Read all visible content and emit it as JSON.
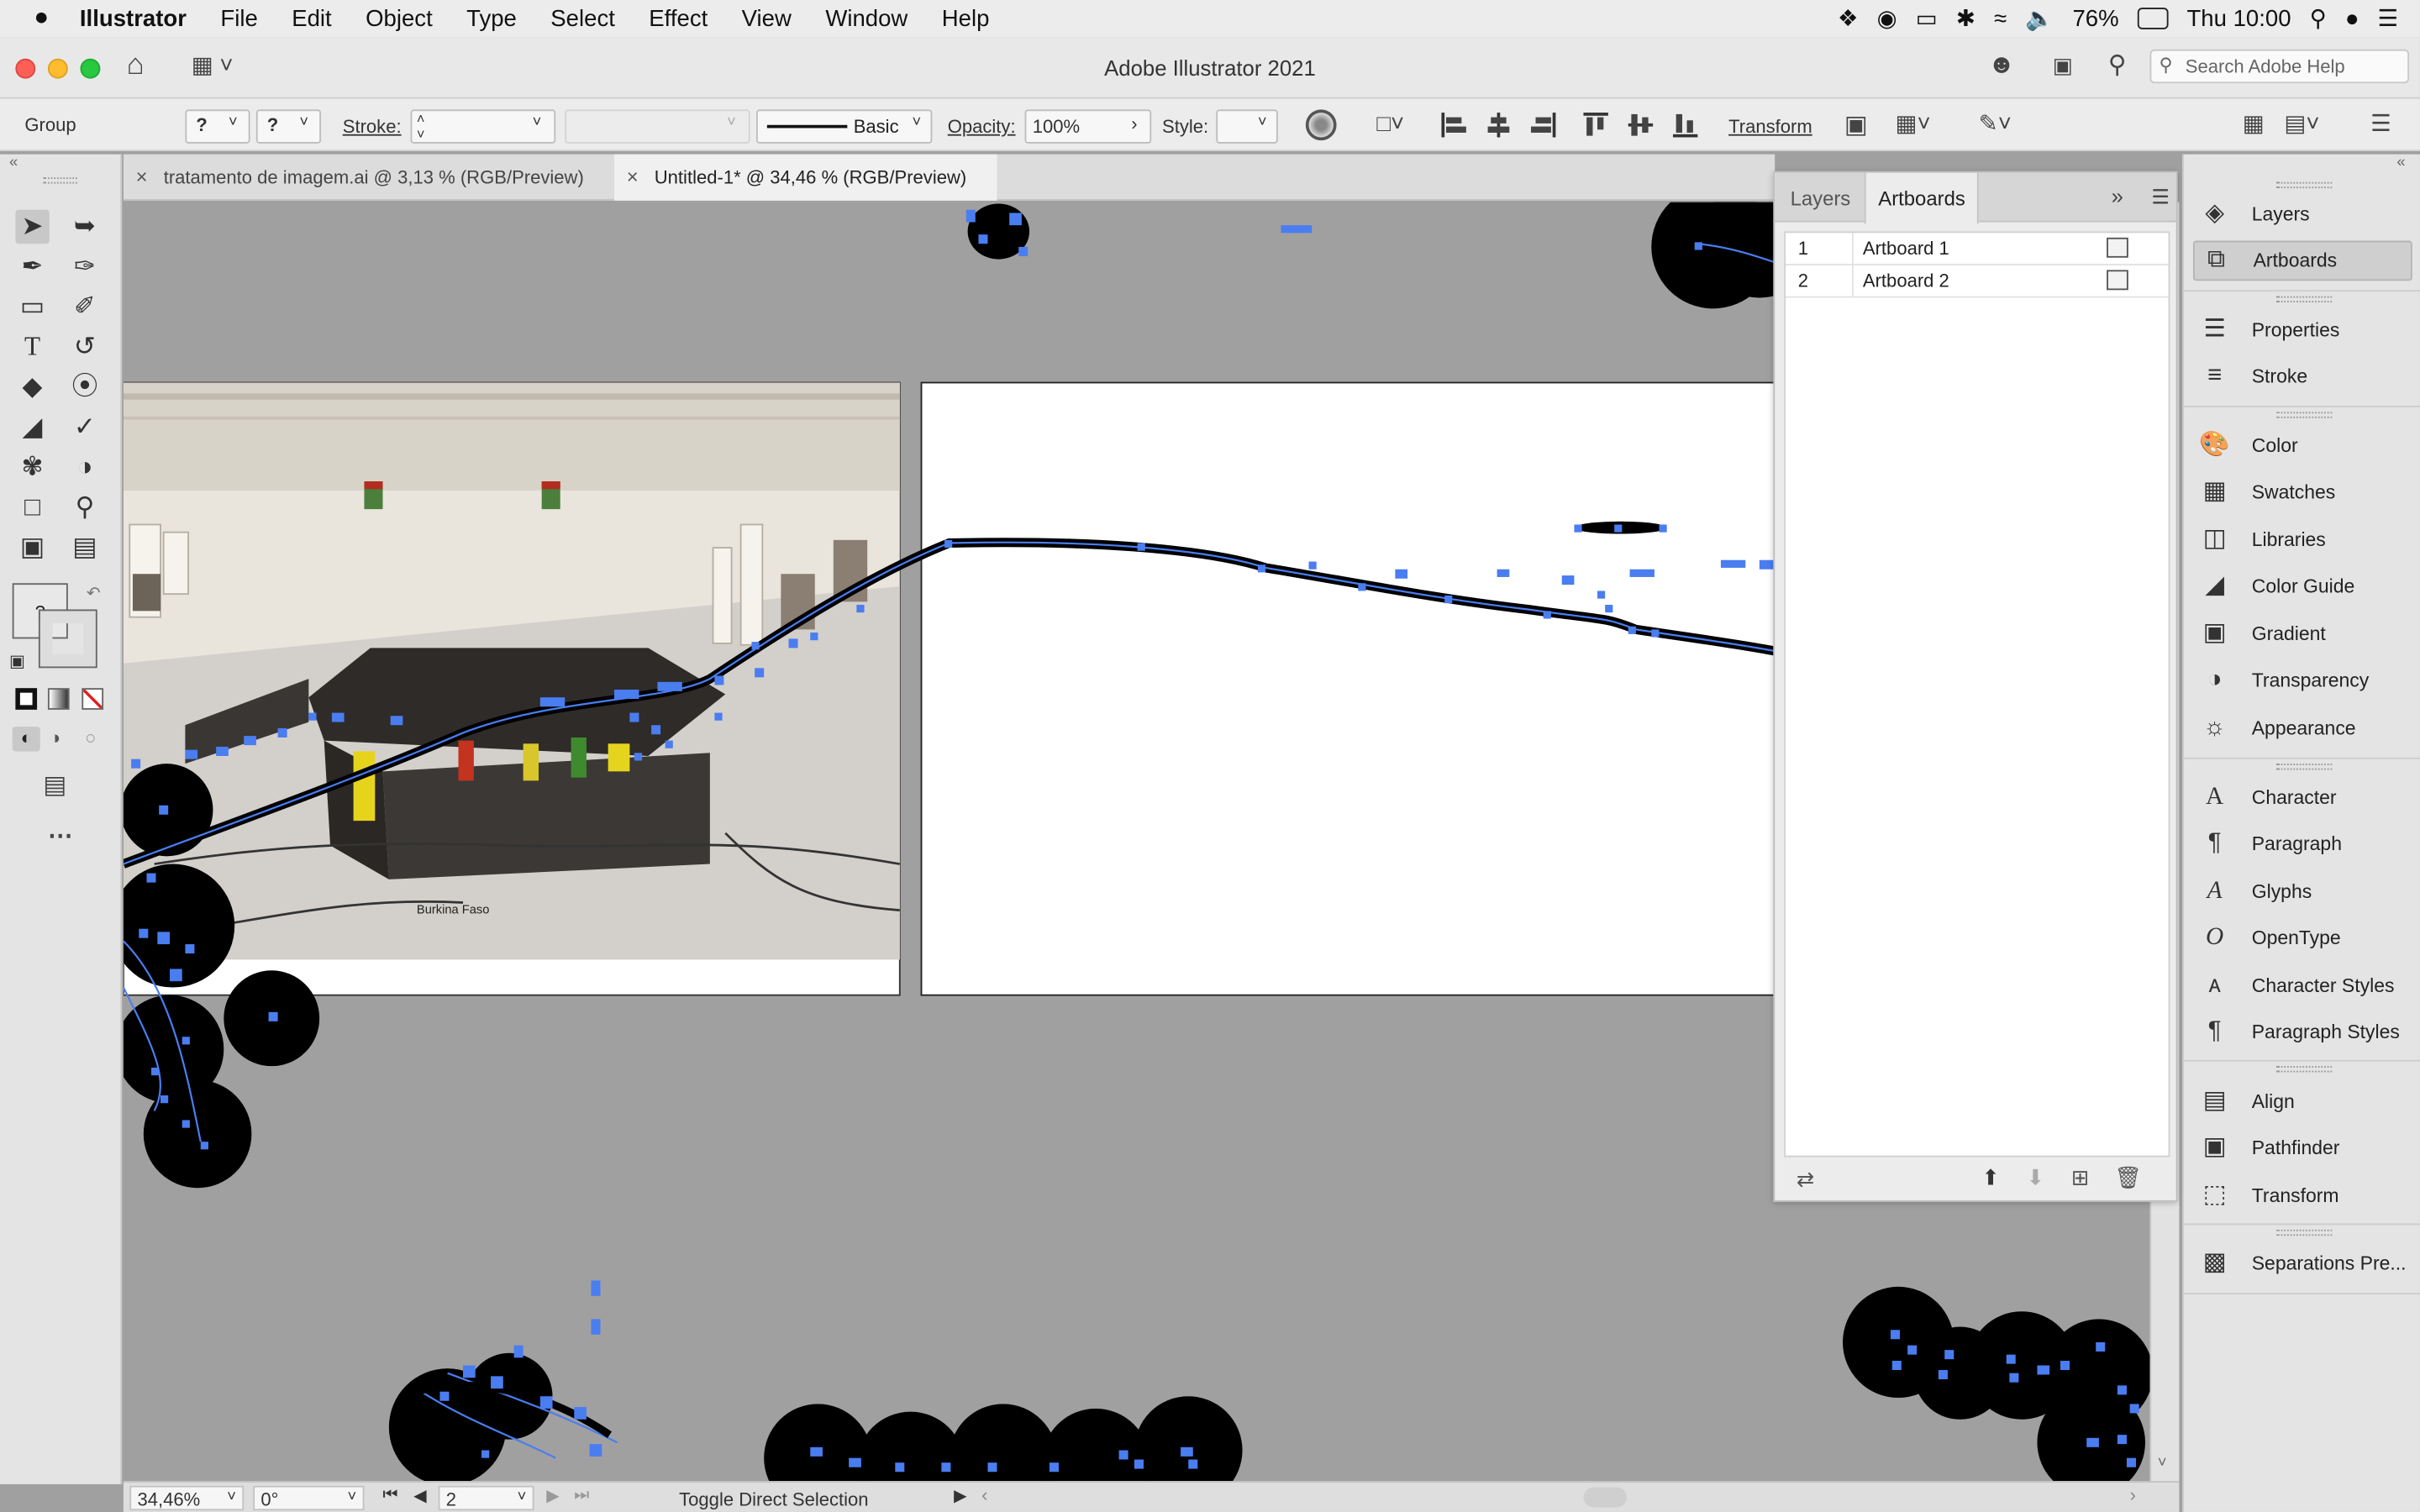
{
  "menubar": {
    "app_name": "Illustrator",
    "items": [
      "File",
      "Edit",
      "Object",
      "Type",
      "Select",
      "Effect",
      "View",
      "Window",
      "Help"
    ],
    "battery": "76%",
    "clock": "Thu 10:00"
  },
  "titlebar": {
    "title": "Adobe Illustrator 2021",
    "search_placeholder": "Search Adobe Help"
  },
  "controlbar": {
    "selection_type": "Group",
    "fill_label": "?",
    "stroke_q": "?",
    "stroke_label": "Stroke:",
    "brush_label": "Basic",
    "opacity_label": "Opacity:",
    "opacity_value": "100%",
    "style_label": "Style:",
    "transform_label": "Transform"
  },
  "tabs": [
    {
      "label": "tratamento de imagem.ai @ 3,13 % (RGB/Preview)",
      "active": false
    },
    {
      "label": "Untitled-1* @ 34,46 % (RGB/Preview)",
      "active": true
    }
  ],
  "artboards_panel": {
    "tab_layers": "Layers",
    "tab_artboards": "Artboards",
    "rows": [
      {
        "num": "1",
        "name": "Artboard 1"
      },
      {
        "num": "2",
        "name": "Artboard 2"
      }
    ]
  },
  "dock": {
    "groups": [
      [
        "Layers",
        "Artboards"
      ],
      [
        "Properties",
        "Stroke"
      ],
      [
        "Color",
        "Swatches",
        "Libraries",
        "Color Guide",
        "Gradient",
        "Transparency",
        "Appearance"
      ],
      [
        "Character",
        "Paragraph",
        "Glyphs",
        "OpenType",
        "Character Styles",
        "Paragraph Styles"
      ],
      [
        "Align",
        "Pathfinder",
        "Transform"
      ],
      [
        "Separations Pre..."
      ]
    ],
    "selected": "Artboards"
  },
  "statusbar": {
    "zoom": "34,46%",
    "rotation": "0°",
    "artboard_nav": "2",
    "status_text": "Toggle Direct Selection"
  },
  "photo": {
    "map_label": "Burkina Faso"
  },
  "colors": {
    "path_blue": "#4a7df0",
    "canvas_gray": "#a0a0a0",
    "panel_gray": "#ececec"
  }
}
